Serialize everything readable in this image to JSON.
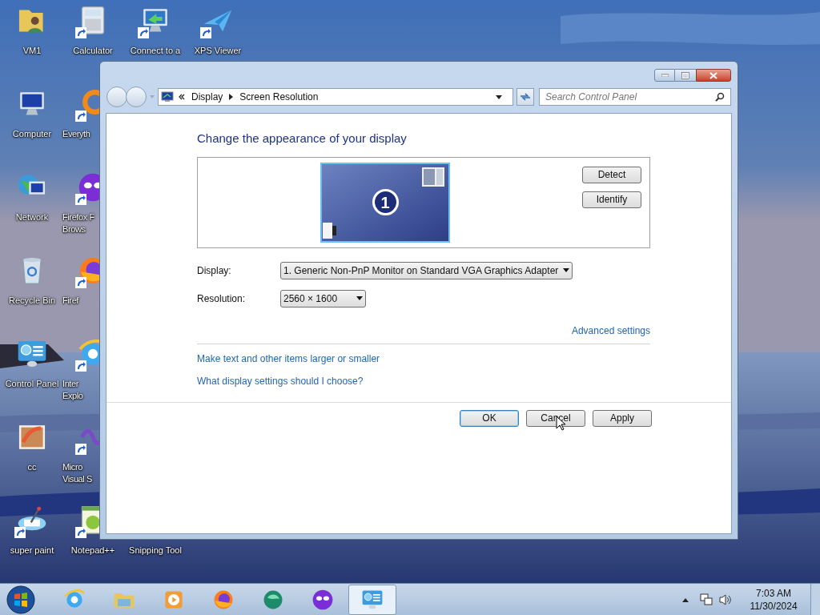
{
  "desktop_columns": [
    [
      {
        "kind": "user-folder",
        "lines": [
          "VM1"
        ],
        "shortcut": false,
        "cut": false
      },
      {
        "kind": "computer",
        "lines": [
          "Computer"
        ],
        "shortcut": false,
        "cut": false
      },
      {
        "kind": "network",
        "lines": [
          "Network"
        ],
        "shortcut": false,
        "cut": false
      },
      {
        "kind": "recycle-bin",
        "lines": [
          "Recycle Bin"
        ],
        "shortcut": false,
        "cut": false
      },
      {
        "kind": "control-panel",
        "lines": [
          "Control Panel"
        ],
        "shortcut": false,
        "cut": false
      },
      {
        "kind": "painting",
        "lines": [
          "cc"
        ],
        "shortcut": false,
        "cut": false
      },
      {
        "kind": "paint-tool",
        "lines": [
          "super paint"
        ],
        "shortcut": true,
        "cut": false
      }
    ],
    [
      {
        "kind": "calculator",
        "lines": [
          "Calculator"
        ],
        "shortcut": true,
        "cut": false
      },
      {
        "kind": "ring",
        "lines": [
          "Everyth"
        ],
        "shortcut": true,
        "cut": true
      },
      {
        "kind": "mask",
        "lines": [
          "Firefox F",
          "Brows"
        ],
        "shortcut": true,
        "cut": true
      },
      {
        "kind": "firefox",
        "lines": [
          "Firef"
        ],
        "shortcut": true,
        "cut": true
      },
      {
        "kind": "ie",
        "lines": [
          "Inter",
          "Explo"
        ],
        "shortcut": true,
        "cut": true
      },
      {
        "kind": "infinity",
        "lines": [
          "Micro",
          "Visual S"
        ],
        "shortcut": true,
        "cut": true
      },
      {
        "kind": "notepad",
        "lines": [
          "Notepad++"
        ],
        "shortcut": true,
        "cut": false
      }
    ],
    [
      {
        "kind": "remote",
        "lines": [
          "Connect to a"
        ],
        "shortcut": true,
        "cut": false
      },
      null,
      null,
      null,
      null,
      null,
      {
        "lines": [
          "Snipping Tool"
        ],
        "cut": false
      }
    ],
    [
      {
        "kind": "plane",
        "lines": [
          "XPS Viewer"
        ],
        "shortcut": true,
        "cut": false
      }
    ]
  ],
  "window": {
    "address": {
      "crumbs": [
        "Display",
        "Screen Resolution"
      ]
    },
    "search": {
      "placeholder": "Search Control Panel"
    },
    "heading": "Change the appearance of your display",
    "monitor": {
      "number": "1",
      "selected": true
    },
    "side_buttons": [
      "Detect",
      "Identify"
    ],
    "fields": [
      {
        "label": "Display:",
        "value": "1. Generic Non-PnP Monitor on Standard VGA Graphics Adapter"
      },
      {
        "label": "Resolution:",
        "value": "2560 × 1600"
      }
    ],
    "advanced_link": "Advanced settings",
    "links": [
      "Make text and other items larger or smaller",
      "What display settings should I choose?"
    ],
    "buttons": [
      {
        "label": "OK",
        "selected": true
      },
      {
        "label": "Cancel",
        "selected": false
      },
      {
        "label": "Apply",
        "selected": false
      }
    ]
  },
  "taskbar": {
    "items": [
      {
        "kind": "ie",
        "selected": false
      },
      {
        "kind": "explorer",
        "selected": false
      },
      {
        "kind": "media",
        "selected": false
      },
      {
        "kind": "firefox",
        "selected": false
      },
      {
        "kind": "green",
        "selected": false
      },
      {
        "kind": "mask",
        "selected": false
      },
      {
        "kind": "control-panel",
        "selected": true
      }
    ],
    "time": "7:03 AM",
    "date": "11/30/2024"
  }
}
